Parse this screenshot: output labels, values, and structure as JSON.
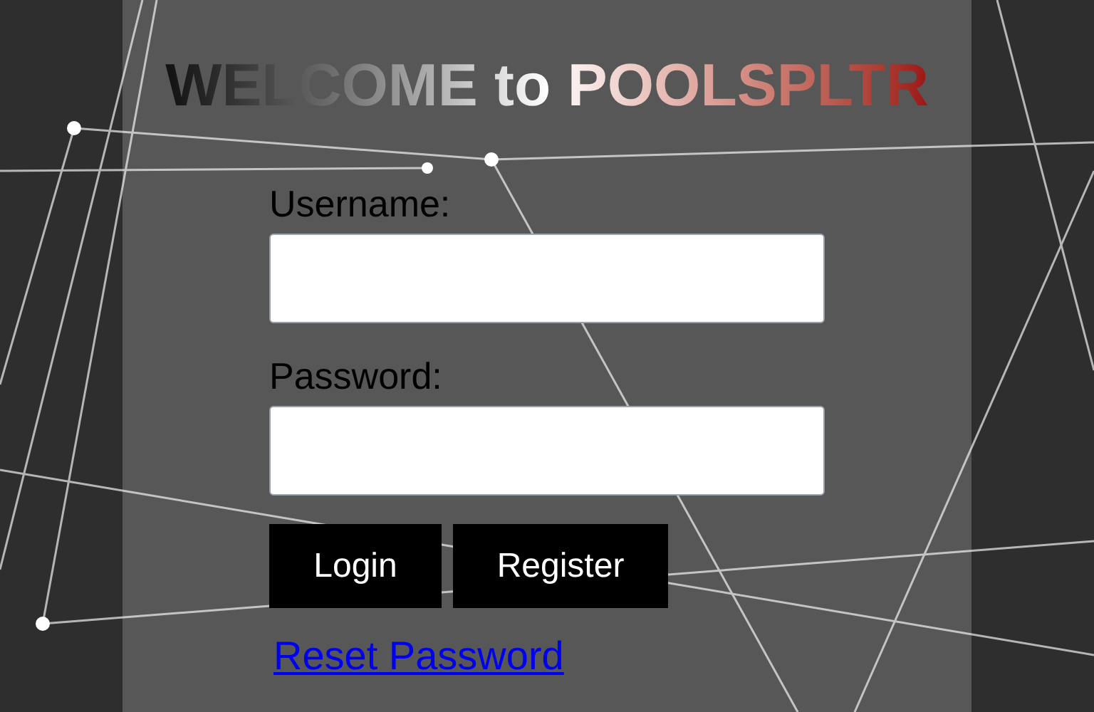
{
  "title": "WELCOME to POOLSPLTR",
  "fields": [
    {
      "label": "Username:"
    },
    {
      "label": "Password:"
    }
  ],
  "buttons": [
    "Login",
    "Register"
  ],
  "link": "Reset Password"
}
